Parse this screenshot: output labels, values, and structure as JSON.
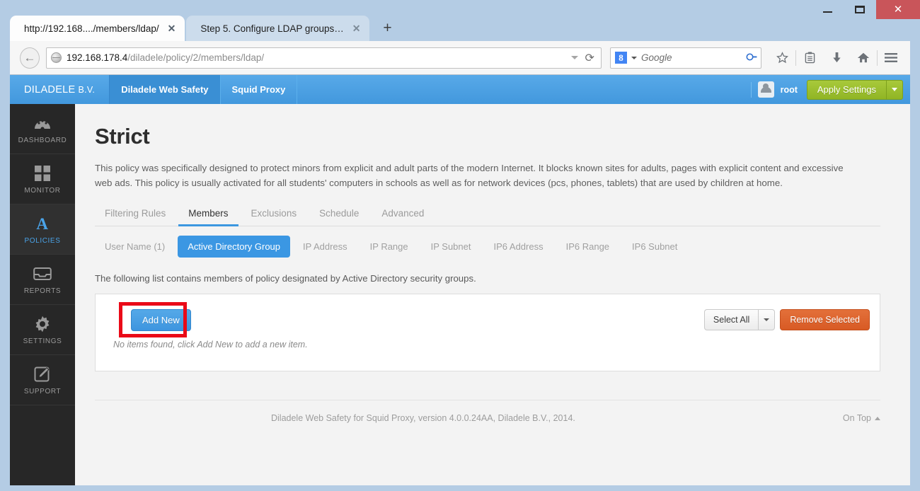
{
  "window": {
    "controls": {
      "minimize": "minimize-button",
      "maximize": "maximize-button",
      "close": "✕"
    }
  },
  "browser": {
    "tabs": [
      {
        "title": "http://192.168..../members/ldap/",
        "close": "✕",
        "active": true
      },
      {
        "title": "Step 5. Configure LDAP groups…",
        "close": "✕",
        "active": false
      }
    ],
    "new_tab_label": "+",
    "back_arrow": "←",
    "url": {
      "host": "192.168.178.4",
      "path": "/diladele/policy/2/members/ldap/"
    },
    "url_dropdown": "chevron-down-icon",
    "reload": "⟳",
    "search": {
      "engine_badge": "8",
      "placeholder": "Google",
      "magnifier": "⚲"
    },
    "toolbar_icons": [
      "bookmark-star-icon",
      "reading-list-icon",
      "downloads-icon",
      "home-icon",
      "menu-icon"
    ]
  },
  "app": {
    "brand": {
      "name": "DILADELE",
      "suffix": "B.V."
    },
    "nav": [
      {
        "label": "Diladele Web Safety",
        "active": true
      },
      {
        "label": "Squid Proxy",
        "active": false
      }
    ],
    "user": "root",
    "apply_button": "Apply Settings",
    "apply_caret": "chevron-down-icon"
  },
  "sidebar": {
    "items": [
      {
        "label": "DASHBOARD",
        "icon": "dashboard-gauge-icon",
        "active": false
      },
      {
        "label": "MONITOR",
        "icon": "grid-squares-icon",
        "active": false
      },
      {
        "label": "POLICIES",
        "icon": "letter-a-icon",
        "active": true
      },
      {
        "label": "REPORTS",
        "icon": "inbox-tray-icon",
        "active": false
      },
      {
        "label": "SETTINGS",
        "icon": "gear-icon",
        "active": false
      },
      {
        "label": "SUPPORT",
        "icon": "pencil-square-icon",
        "active": false
      }
    ]
  },
  "main": {
    "title": "Strict",
    "description": "This policy was specifically designed to protect minors from explicit and adult parts of the modern Internet. It blocks known sites for adults, pages with explicit content and excessive web ads. This policy is usually activated for all students' computers in schools as well as for network devices (pcs, phones, tablets) that are used by children at home.",
    "tabs": [
      {
        "label": "Filtering Rules",
        "active": false
      },
      {
        "label": "Members",
        "active": true
      },
      {
        "label": "Exclusions",
        "active": false
      },
      {
        "label": "Schedule",
        "active": false
      },
      {
        "label": "Advanced",
        "active": false
      }
    ],
    "subtabs": [
      {
        "label": "User Name (1)",
        "active": false
      },
      {
        "label": "Active Directory Group",
        "active": true
      },
      {
        "label": "IP Address",
        "active": false
      },
      {
        "label": "IP Range",
        "active": false
      },
      {
        "label": "IP Subnet",
        "active": false
      },
      {
        "label": "IP6 Address",
        "active": false
      },
      {
        "label": "IP6 Range",
        "active": false
      },
      {
        "label": "IP6 Subnet",
        "active": false
      }
    ],
    "list_intro": "The following list contains members of policy designated by Active Directory security groups.",
    "add_new": "Add New",
    "select_all": "Select All",
    "select_all_caret": "chevron-down-icon",
    "remove_selected": "Remove Selected",
    "empty_message": "No items found, click Add New to add a new item.",
    "highlight_color": "#ea0a18"
  },
  "footer": {
    "text": "Diladele Web Safety for Squid Proxy, version 4.0.0.24AA, Diladele B.V., 2014.",
    "on_top": "On Top",
    "on_top_caret": "chevron-up-icon"
  }
}
